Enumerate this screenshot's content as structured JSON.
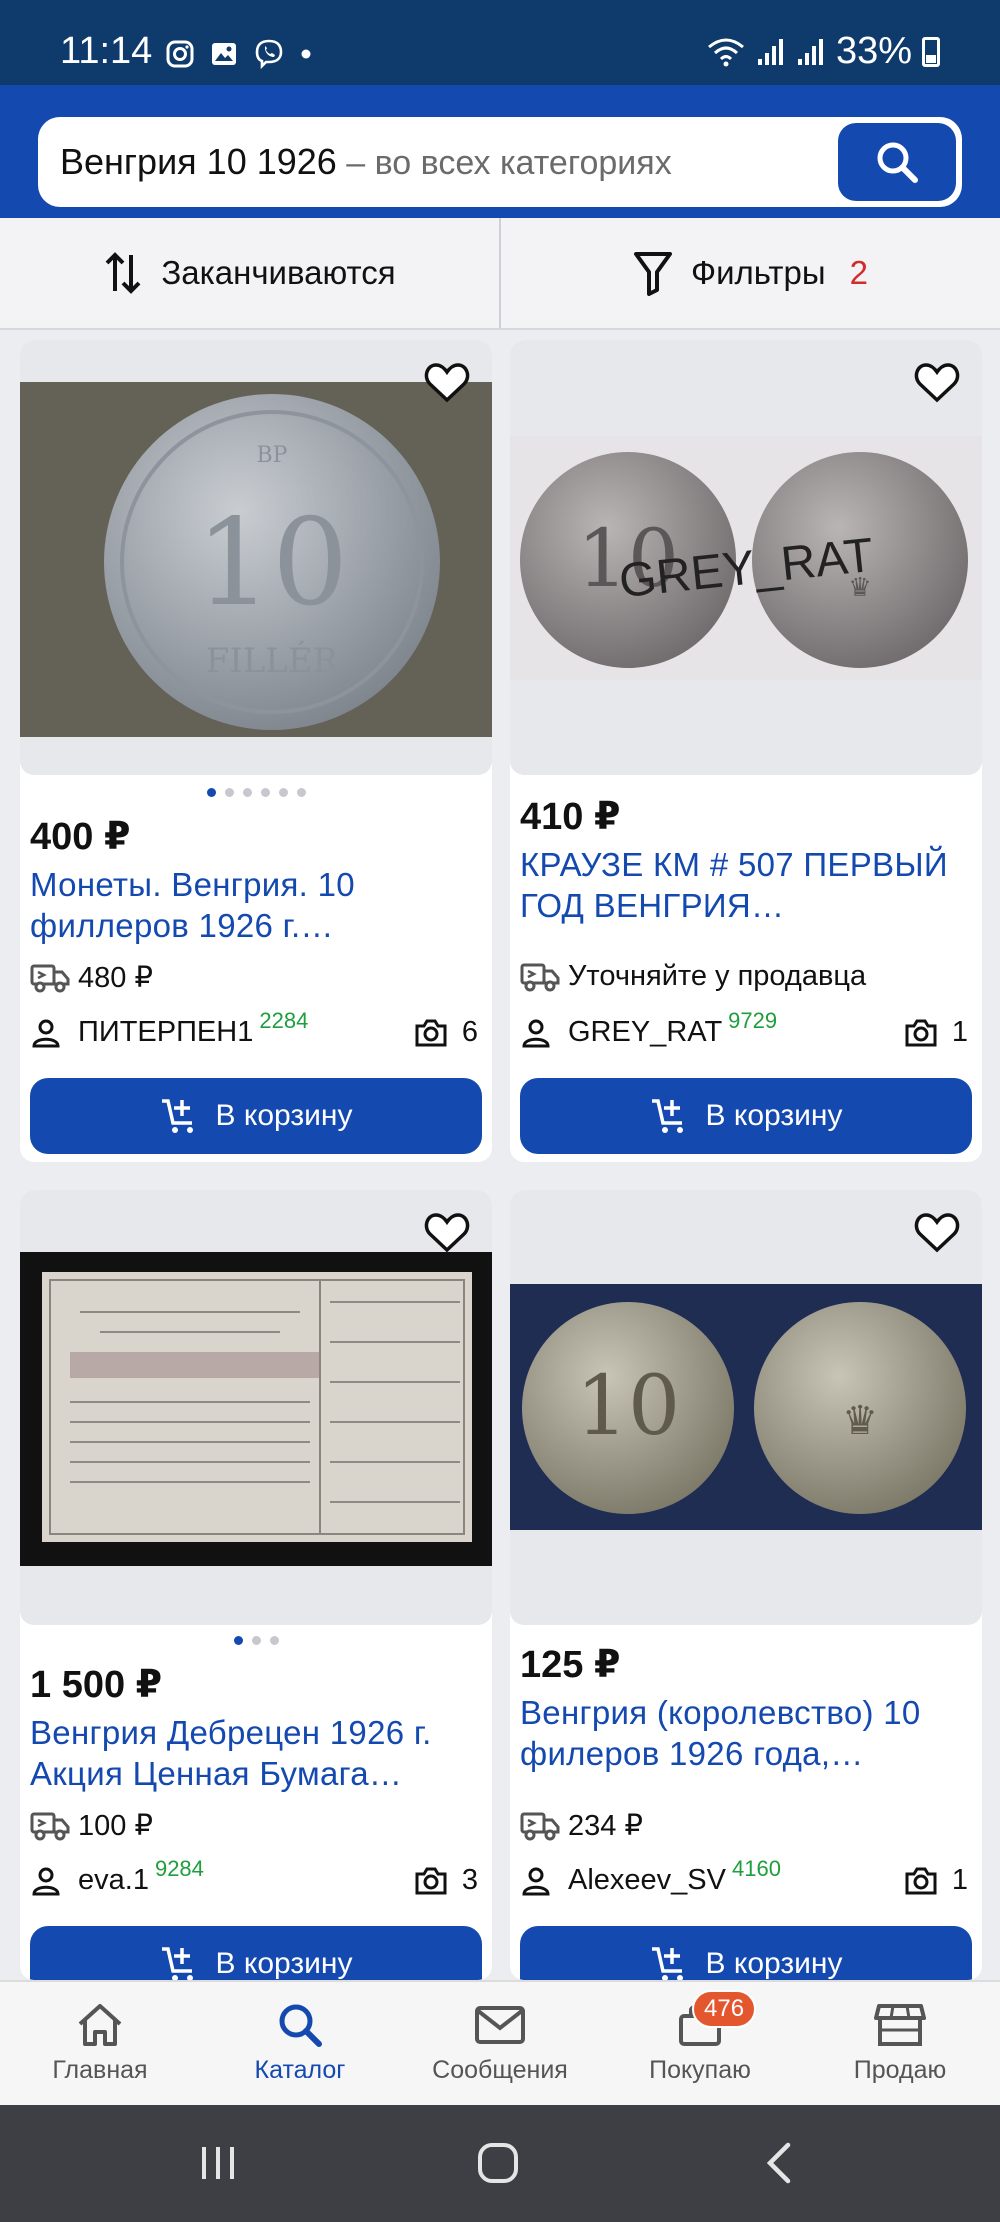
{
  "status_bar": {
    "time": "11:14",
    "battery": "33%",
    "icons": [
      "instagram-icon",
      "gallery-icon",
      "viber-icon",
      "dot-icon",
      "wifi-icon",
      "signal-icon",
      "signal-icon",
      "battery-icon"
    ]
  },
  "search": {
    "query": "Венгрия 10 1926",
    "hint": " – во всех категориях"
  },
  "sortbar": {
    "sort_label": "Заканчиваются",
    "filter_label": "Фильтры",
    "filter_count": "2"
  },
  "colors": {
    "brand": "#1449b0",
    "status_bar": "#0e3a6c",
    "rating": "#1f9e3e",
    "badge": "#e4572e"
  },
  "listings": [
    {
      "price": "400 ₽",
      "title_line1": "Монеты. Венгрия. 10",
      "title_line2": "филлеров 1926 г.…",
      "delivery": "480 ₽",
      "seller": "ПИТЕРПЕН1",
      "rating": "2284",
      "photos": "6",
      "cart_label": "В корзину",
      "image_dots": 6,
      "active_dot": 0
    },
    {
      "price": "410 ₽",
      "title_line1": "КРАУЗЕ КМ # 507 ПЕРВЫЙ",
      "title_line2": "ГОД ВЕНГРИЯ…",
      "delivery": "Уточняйте у продавца",
      "seller": "GREY_RAT",
      "rating": "9729",
      "photos": "1",
      "cart_label": "В корзину",
      "image_text": "GREY_RAT"
    },
    {
      "price": "1 500 ₽",
      "title_line1": "Венгрия Дебрецен 1926 г.",
      "title_line2": "Акция Ценная Бумага…",
      "delivery": "100 ₽",
      "seller": "eva.1",
      "rating": "9284",
      "photos": "3",
      "cart_label": "В корзину",
      "image_dots": 3,
      "active_dot": 0
    },
    {
      "price": "125 ₽",
      "title_line1": "Венгрия (королевство) 10",
      "title_line2": "филеров 1926 года,…",
      "delivery": "234 ₽",
      "seller": "Alexeev_SV",
      "rating": "4160",
      "photos": "1",
      "cart_label": "В корзину"
    }
  ],
  "bottom_nav": [
    {
      "label": "Главная",
      "icon": "home-icon"
    },
    {
      "label": "Каталог",
      "icon": "search-icon"
    },
    {
      "label": "Сообщения",
      "icon": "mail-icon"
    },
    {
      "label": "Покупаю",
      "icon": "bag-icon",
      "badge": "476"
    },
    {
      "label": "Продаю",
      "icon": "store-icon"
    }
  ]
}
